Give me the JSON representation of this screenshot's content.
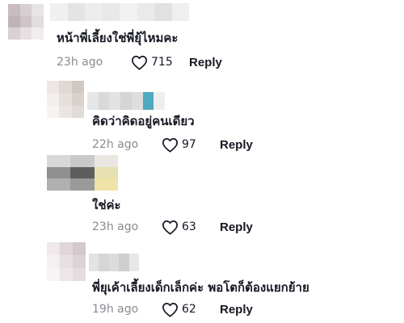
{
  "comments": [
    {
      "text": "หน้าพี่เลี้ยงใช่พี่ยุ้ไหมคะ",
      "timestamp": "23h ago",
      "likes": "715",
      "reply_label": "Reply"
    },
    {
      "text": "คิดว่าคิดอยู่คนเดียว",
      "timestamp": "22h ago",
      "likes": "97",
      "reply_label": "Reply"
    },
    {
      "text": "ใช่ค่ะ",
      "timestamp": "23h ago",
      "likes": "63",
      "reply_label": "Reply"
    },
    {
      "text": "พี่ยุเค้าเลี้ยงเด็กเล็กค่ะ พอโตก็ต้องแยกย้าย",
      "timestamp": "19h ago",
      "likes": "62",
      "reply_label": "Reply"
    }
  ],
  "colors": {
    "text": "#161823",
    "secondary": "#8a8b91",
    "avatar_1": [
      "#c9bcc0",
      "#d7cfd2",
      "#e8e3e5",
      "#bfb3b6",
      "#cfc5c8",
      "#e2dcde",
      "#d9d1d4",
      "#e6e0e2",
      "#f1eded"
    ],
    "avatar_2": [
      "#ece7e4",
      "#e0d8d4",
      "#cfc8c3",
      "#f3efed",
      "#e6e0dc",
      "#d8d1cc",
      "#f6f3f1",
      "#ebe6e3",
      "#e1dbd7"
    ],
    "avatar_3": [
      "#d8d8d8",
      "#c9c9c9",
      "#eae7e0",
      "#8f8f8f",
      "#5e5e5e",
      "#e7e0b0",
      "#b0b0b0",
      "#9a9a9a",
      "#efe3a8"
    ],
    "avatar_4": [
      "#efe9ea",
      "#e0d6d8",
      "#d3c9cb",
      "#f4eff0",
      "#e7dfe1",
      "#dcd3d5",
      "#f7f4f4",
      "#ece6e7",
      "#e4dcde"
    ],
    "username_1": [
      "#f0f0f0",
      "#e4e4e4",
      "#ededed",
      "#e8e8e8",
      "#f2f2f2",
      "#eaeaea",
      "#e1e1e1",
      "#efefef"
    ],
    "username_2": [
      "#e6e6e6",
      "#d9d9d9",
      "#e2e2e2",
      "#d5d5d5",
      "#dedede",
      "#4fa9bf",
      "#eeeeee"
    ],
    "username_4": [
      "#e3e3e3",
      "#d6d6d6",
      "#dcdcdc",
      "#cfcfcf",
      "#e7e7e7"
    ]
  },
  "icons": {
    "like": "heart-outline-icon"
  }
}
